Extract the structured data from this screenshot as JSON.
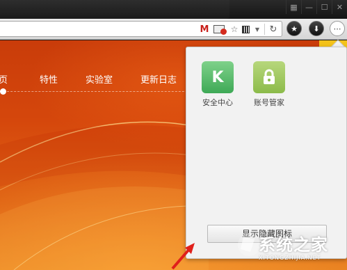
{
  "window": {
    "controls": [
      {
        "name": "skin-icon",
        "glyph": "▦"
      },
      {
        "name": "minimize-icon",
        "glyph": "—"
      },
      {
        "name": "maximize-icon",
        "glyph": "☐"
      },
      {
        "name": "close-icon",
        "glyph": "✕"
      }
    ]
  },
  "toolbar": {
    "gmail_glyph": "M",
    "star_glyph": "☆",
    "caret_glyph": "▼",
    "reload_glyph": "↻",
    "buttons": [
      {
        "name": "favorites-star-icon",
        "glyph": "★"
      },
      {
        "name": "download-icon",
        "glyph": "⬇"
      },
      {
        "name": "more-icon",
        "glyph": "⋯"
      }
    ]
  },
  "page": {
    "nav": [
      "首页",
      "特性",
      "实验室",
      "更新日志"
    ],
    "nav_visible": [
      "页",
      "特性",
      "实验室",
      "更新日志"
    ]
  },
  "popup": {
    "apps": [
      {
        "label": "安全中心",
        "icon_char": "K",
        "icon": "security-center-icon"
      },
      {
        "label": "账号管家",
        "icon_char": "🔒",
        "icon": "lock-icon"
      }
    ],
    "show_hidden_button": "显示隐藏图标"
  },
  "watermark": {
    "text": "系统之家",
    "sub": "XITONGZHIJIA.NET"
  },
  "colors": {
    "accent_orange": "#d5470c",
    "arrow_red": "#e0201b",
    "app_green": "#3ea956"
  }
}
